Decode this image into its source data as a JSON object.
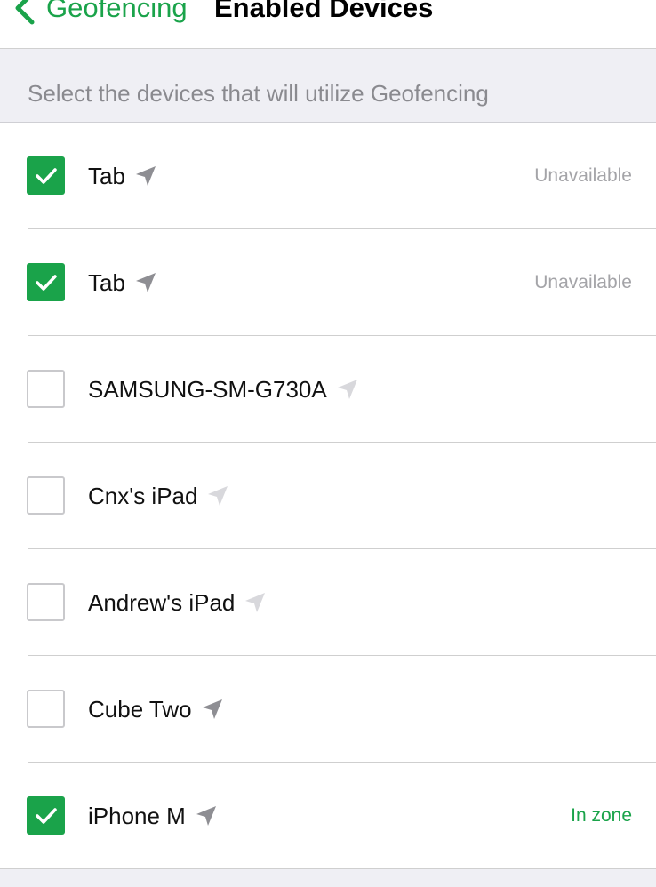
{
  "nav": {
    "back_label": "Geofencing",
    "title": "Enabled Devices"
  },
  "section": {
    "header": "Select the devices that will utilize Geofencing"
  },
  "colors": {
    "accent": "#1aa34a",
    "location_icon_active": "#8e8e93",
    "location_icon_faded": "#d8d8dc",
    "status_unavailable": "#a4a4a8",
    "status_in_zone": "#1aa34a"
  },
  "devices": [
    {
      "name": "Tab",
      "checked": true,
      "status": "Unavailable",
      "status_kind": "unavailable",
      "location_icon": "location-arrow-icon",
      "location_active": true
    },
    {
      "name": "Tab",
      "checked": true,
      "status": "Unavailable",
      "status_kind": "unavailable",
      "location_icon": "location-arrow-icon",
      "location_active": true
    },
    {
      "name": "SAMSUNG-SM-G730A",
      "checked": false,
      "status": "",
      "status_kind": "none",
      "location_icon": "location-arrow-icon",
      "location_active": false
    },
    {
      "name": "Cnx's iPad",
      "checked": false,
      "status": "",
      "status_kind": "none",
      "location_icon": "location-arrow-icon",
      "location_active": false
    },
    {
      "name": "Andrew's iPad",
      "checked": false,
      "status": "",
      "status_kind": "none",
      "location_icon": "location-arrow-icon",
      "location_active": false
    },
    {
      "name": "Cube Two",
      "checked": false,
      "status": "",
      "status_kind": "none",
      "location_icon": "location-arrow-icon",
      "location_active": true
    },
    {
      "name": "iPhone M",
      "checked": true,
      "status": "In zone",
      "status_kind": "in_zone",
      "location_icon": "location-arrow-icon",
      "location_active": true
    }
  ]
}
